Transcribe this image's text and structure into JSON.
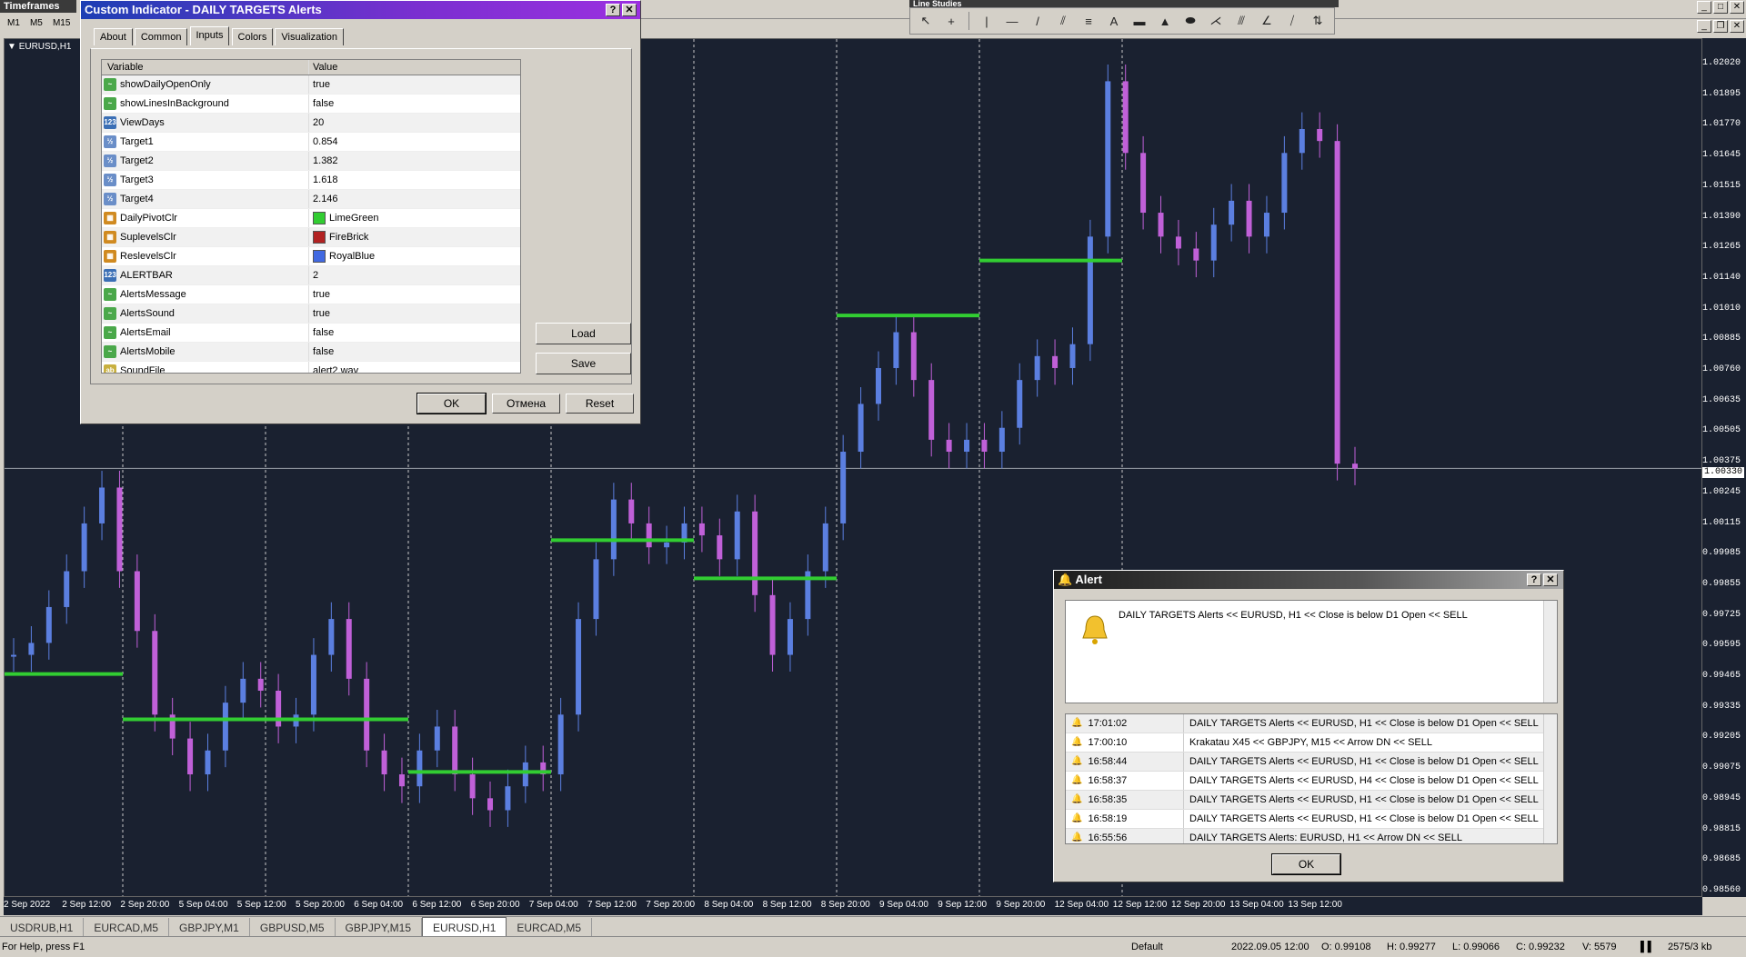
{
  "timeframes": {
    "title": "Timeframes",
    "buttons": [
      "M1",
      "M5",
      "M15"
    ]
  },
  "line_studies": {
    "title": "Line Studies"
  },
  "chart": {
    "symbol": "EURUSD,H1",
    "current_price": "1.00330",
    "price_ticks": [
      "1.02020",
      "1.01895",
      "1.01770",
      "1.01645",
      "1.01515",
      "1.01390",
      "1.01265",
      "1.01140",
      "1.01010",
      "1.00885",
      "1.00760",
      "1.00635",
      "1.00505",
      "1.00375",
      "1.00245",
      "1.00115",
      "0.99985",
      "0.99855",
      "0.99725",
      "0.99595",
      "0.99465",
      "0.99335",
      "0.99205",
      "0.99075",
      "0.98945",
      "0.98815",
      "0.98685",
      "0.98560"
    ],
    "time_ticks": [
      "2 Sep 2022",
      "2 Sep 12:00",
      "2 Sep 20:00",
      "5 Sep 04:00",
      "5 Sep 12:00",
      "5 Sep 20:00",
      "6 Sep 04:00",
      "6 Sep 12:00",
      "6 Sep 20:00",
      "7 Sep 04:00",
      "7 Sep 12:00",
      "7 Sep 20:00",
      "8 Sep 04:00",
      "8 Sep 12:00",
      "8 Sep 20:00",
      "9 Sep 04:00",
      "9 Sep 12:00",
      "9 Sep 20:00",
      "12 Sep 04:00",
      "12 Sep 12:00",
      "12 Sep 20:00",
      "13 Sep 04:00",
      "13 Sep 12:00"
    ],
    "colors": {
      "bull": "#5b7fe0",
      "bear": "#c060d8",
      "pivot": "#32cd32",
      "background": "#1a2130"
    }
  },
  "custom_indicator": {
    "title": "Custom Indicator - DAILY TARGETS Alerts",
    "tabs": [
      "About",
      "Common",
      "Inputs",
      "Colors",
      "Visualization"
    ],
    "active_tab": "Inputs",
    "headers": {
      "variable": "Variable",
      "value": "Value"
    },
    "params": [
      {
        "name": "showDailyOpenOnly",
        "value": "true",
        "icon": "bool"
      },
      {
        "name": "showLinesInBackground",
        "value": "false",
        "icon": "bool"
      },
      {
        "name": "ViewDays",
        "value": "20",
        "icon": "int"
      },
      {
        "name": "Target1",
        "value": "0.854",
        "icon": "double"
      },
      {
        "name": "Target2",
        "value": "1.382",
        "icon": "double"
      },
      {
        "name": "Target3",
        "value": "1.618",
        "icon": "double"
      },
      {
        "name": "Target4",
        "value": "2.146",
        "icon": "double"
      },
      {
        "name": "DailyPivotClr",
        "value": "LimeGreen",
        "icon": "color",
        "swatch": "#32cd32"
      },
      {
        "name": "SuplevelsClr",
        "value": "FireBrick",
        "icon": "color",
        "swatch": "#b22222"
      },
      {
        "name": "ReslevelsClr",
        "value": "RoyalBlue",
        "icon": "color",
        "swatch": "#4169e1"
      },
      {
        "name": "ALERTBAR",
        "value": "2",
        "icon": "int"
      },
      {
        "name": "AlertsMessage",
        "value": "true",
        "icon": "bool"
      },
      {
        "name": "AlertsSound",
        "value": "true",
        "icon": "bool"
      },
      {
        "name": "AlertsEmail",
        "value": "false",
        "icon": "bool"
      },
      {
        "name": "AlertsMobile",
        "value": "false",
        "icon": "bool"
      },
      {
        "name": "SoundFile",
        "value": "alert2.wav",
        "icon": "string"
      }
    ],
    "load_label": "Load",
    "save_label": "Save",
    "ok_label": "OK",
    "cancel_label": "Отмена",
    "reset_label": "Reset"
  },
  "alert": {
    "title": "Alert",
    "message": "DAILY TARGETS Alerts << EURUSD, H1 << Close is below D1 Open << SELL",
    "log": [
      {
        "time": "17:01:02",
        "text": "DAILY TARGETS Alerts << EURUSD, H1 << Close is below D1 Open << SELL"
      },
      {
        "time": "17:00:10",
        "text": "Krakatau X45 << GBPJPY, M15 << Arrow DN << SELL"
      },
      {
        "time": "16:58:44",
        "text": "DAILY TARGETS Alerts << EURUSD, H1 << Close is below D1 Open << SELL"
      },
      {
        "time": "16:58:37",
        "text": "DAILY TARGETS Alerts << EURUSD, H4 << Close is below D1 Open << SELL"
      },
      {
        "time": "16:58:35",
        "text": "DAILY TARGETS Alerts << EURUSD, H1 << Close is below D1 Open << SELL"
      },
      {
        "time": "16:58:19",
        "text": "DAILY TARGETS Alerts << EURUSD, H1 << Close is below D1 Open << SELL"
      },
      {
        "time": "16:55:56",
        "text": "DAILY TARGETS Alerts:  EURUSD, H1  <<  Arrow DN  <<  SELL"
      }
    ],
    "ok_label": "OK"
  },
  "tabs": [
    "USDRUB,H1",
    "EURCAD,M5",
    "GBPJPY,M1",
    "GBPUSD,M5",
    "GBPJPY,M15",
    "EURUSD,H1",
    "EURCAD,M5"
  ],
  "active_tab": "EURUSD,H1",
  "status": {
    "help": "For Help, press F1",
    "profile": "Default",
    "datetime": "2022.09.05 12:00",
    "open": "O: 0.99108",
    "high": "H: 0.99277",
    "low": "L: 0.99066",
    "close": "C: 0.99232",
    "volume": "V: 5579",
    "traffic": "2575/3 kb"
  }
}
